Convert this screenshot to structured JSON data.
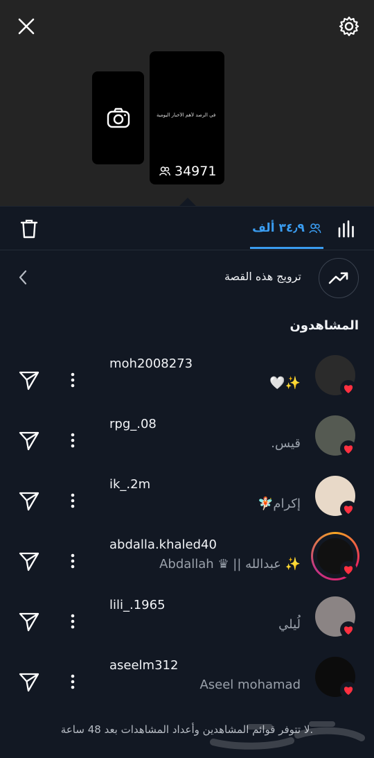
{
  "header": {
    "close_icon": "close-icon",
    "settings_icon": "settings-gear-icon",
    "camera_icon": "camera-icon",
    "story_caption": "اهلاً بكم في الرصد لأهم الأخبار اليومية",
    "story_view_count": "34971"
  },
  "tabs": {
    "delete_icon": "trash-icon",
    "viewers_label": "٣٤٫٩ ألف",
    "stats_icon": "bar-chart-icon"
  },
  "promote": {
    "label": "ترويج هذه القصة",
    "icon": "trending-up-icon"
  },
  "viewers_title": "المشاهدون",
  "viewers": [
    {
      "username": "moh2008273",
      "display_name": "✨🤍",
      "avatar_color": "#2b2b2b"
    },
    {
      "username": "rpg_.08",
      "display_name": "قيس.",
      "avatar_color": "#555a52"
    },
    {
      "username": "ik_.2m",
      "display_name": "إكرام🧚🏻",
      "avatar_color": "#e8d9c8"
    },
    {
      "username": "abdalla.khaled40",
      "display_name": "✨ عبدالله || ♛ Abdallah",
      "avatar_color": "#111111"
    },
    {
      "username": "lili_.1965",
      "display_name": "لُيلي",
      "avatar_color": "#8b8484"
    },
    {
      "username": "aseelm312",
      "display_name": "Aseel mohamad",
      "avatar_color": "#0c0c0c"
    }
  ],
  "footer": "لا تتوفر قوائم المشاهدين وأعداد المشاهدات بعد 48 ساعة.",
  "colors": {
    "accent": "#3a9cf0",
    "heart": "#ff3040",
    "background": "#121823"
  }
}
